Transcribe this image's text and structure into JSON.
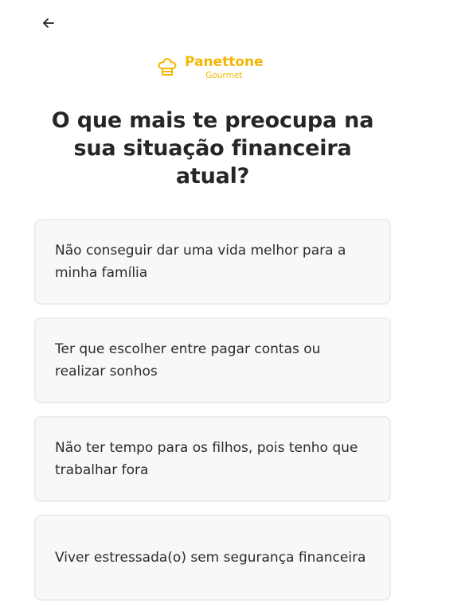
{
  "header": {
    "back_icon": "arrow-left-icon"
  },
  "brand": {
    "icon": "chef-hat-icon",
    "name": "Panettone",
    "subtitle": "Gourmet",
    "color": "#f2b705"
  },
  "question": {
    "title": "O que mais te preocupa na sua situação financeira atual?"
  },
  "options": [
    {
      "label": "Não conseguir dar uma vida melhor para a minha família"
    },
    {
      "label": "Ter que escolher entre pagar contas ou realizar sonhos"
    },
    {
      "label": "Não ter tempo para os filhos, pois tenho que trabalhar fora"
    },
    {
      "label": "Viver estressada(o) sem segurança financeira"
    }
  ]
}
